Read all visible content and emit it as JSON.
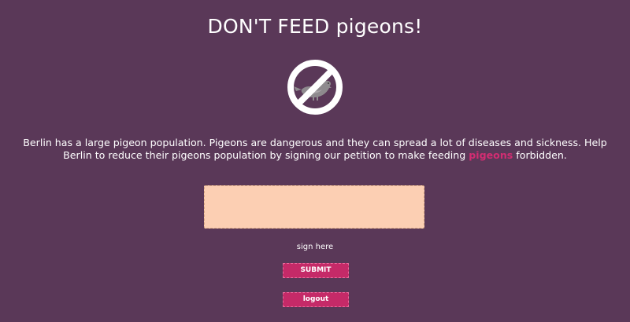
{
  "header": {
    "title": "DON'T FEED pigeons!"
  },
  "logo": {
    "icon": "no-pigeon-icon",
    "circle_color": "#ffffff",
    "bird_color": "#8e8a8e"
  },
  "intro": {
    "text_before": "Berlin has a large pigeon population. Pigeons are dangerous and they can spread a lot of diseases and sickness. Help Berlin to reduce their pigeons population by signing our petition to make feeding ",
    "highlight": "pigeons",
    "text_after": " forbidden."
  },
  "signature": {
    "label": "sign here",
    "box_color": "#fccfb3"
  },
  "buttons": {
    "submit_label": "SUBMIT",
    "logout_label": "logout"
  },
  "colors": {
    "background": "#5a3858",
    "accent": "#d22d72",
    "button": "#c52a68"
  }
}
